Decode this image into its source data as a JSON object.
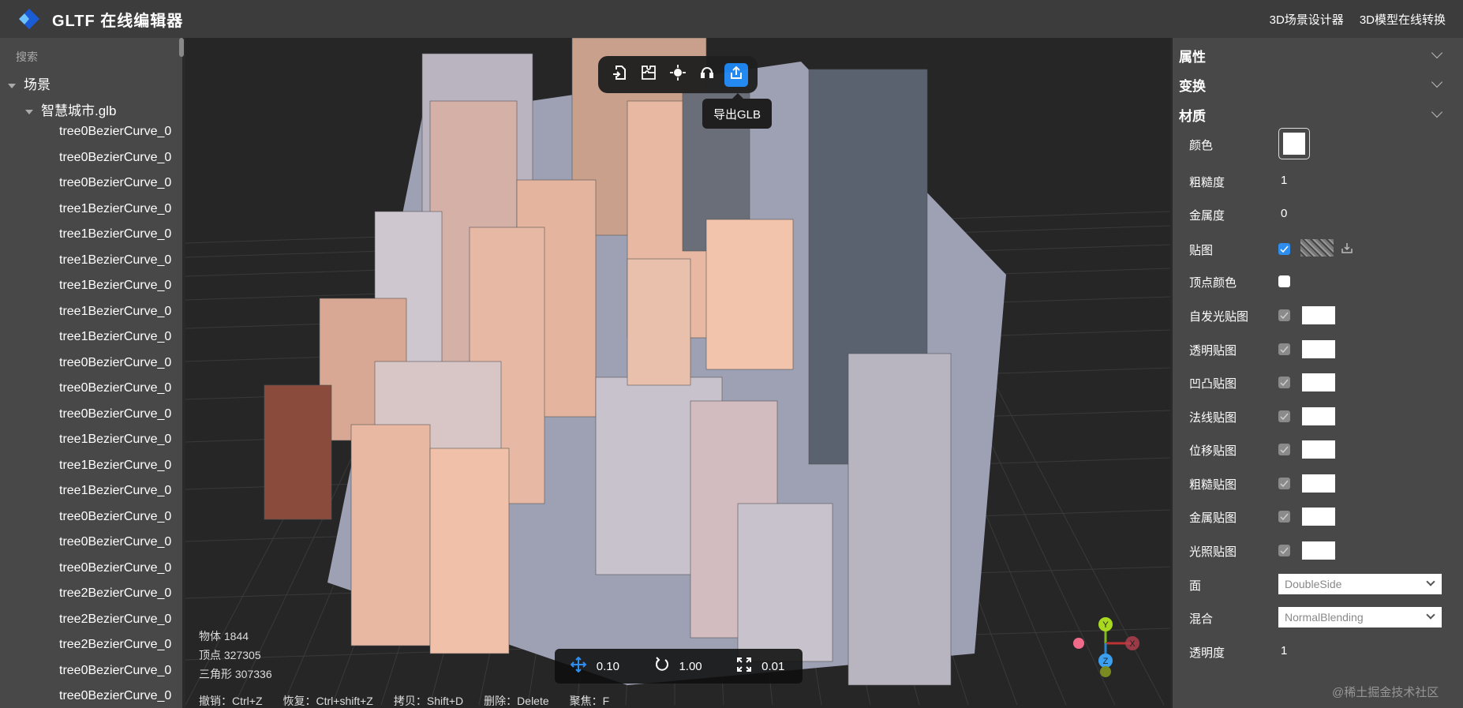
{
  "header": {
    "title": "GLTF 在线编辑器",
    "links": [
      "3D场景设计器",
      "3D模型在线转换"
    ]
  },
  "sidebar": {
    "search_placeholder": "搜索",
    "scene_label": "场景",
    "file_label": "智慧城市.glb",
    "items": [
      "tree0BezierCurve_0",
      "tree0BezierCurve_0",
      "tree0BezierCurve_0",
      "tree1BezierCurve_0",
      "tree1BezierCurve_0",
      "tree1BezierCurve_0",
      "tree1BezierCurve_0",
      "tree1BezierCurve_0",
      "tree1BezierCurve_0",
      "tree0BezierCurve_0",
      "tree0BezierCurve_0",
      "tree0BezierCurve_0",
      "tree1BezierCurve_0",
      "tree1BezierCurve_0",
      "tree1BezierCurve_0",
      "tree0BezierCurve_0",
      "tree0BezierCurve_0",
      "tree0BezierCurve_0",
      "tree2BezierCurve_0",
      "tree2BezierCurve_0",
      "tree2BezierCurve_0",
      "tree0BezierCurve_0",
      "tree0BezierCurve_0"
    ]
  },
  "viewport": {
    "toolbar": {
      "tooltip": "导出GLB",
      "icons": [
        "import-icon",
        "puzzle-icon",
        "light-icon",
        "headset-icon",
        "export-icon"
      ]
    },
    "stats": {
      "objects": "物体 1844",
      "vertices": "顶点 327305",
      "triangles": "三角形 307336"
    },
    "transform": {
      "translate": "0.10",
      "rotate": "1.00",
      "scale": "0.01"
    },
    "hints": [
      "撤销：Ctrl+Z",
      "恢复：Ctrl+shift+Z",
      "拷贝：Shift+D",
      "删除：Delete",
      "聚焦：F"
    ],
    "gizmo": {
      "y": "Y",
      "z": "Z",
      "x": "X"
    }
  },
  "properties": {
    "sections": [
      "属性",
      "变换",
      "材质"
    ],
    "color_label": "颜色",
    "color_value": "#ffffff",
    "roughness_label": "粗糙度",
    "roughness": "1",
    "metalness_label": "金属度",
    "metalness": "0",
    "map_label": "贴图",
    "map_checked": true,
    "vertex_colors_label": "顶点颜色",
    "vertex_colors_checked": false,
    "maps": [
      "自发光贴图",
      "透明贴图",
      "凹凸贴图",
      "法线贴图",
      "位移贴图",
      "粗糙贴图",
      "金属贴图",
      "光照贴图"
    ],
    "side_label": "面",
    "side": "DoubleSide",
    "blending_label": "混合",
    "blending": "NormalBlending",
    "opacity_label": "透明度",
    "opacity": "1"
  },
  "watermark": "@稀土掘金技术社区",
  "colors": {
    "accent": "#1e88f5",
    "panel": "#484848",
    "header": "#3c3c3c"
  }
}
